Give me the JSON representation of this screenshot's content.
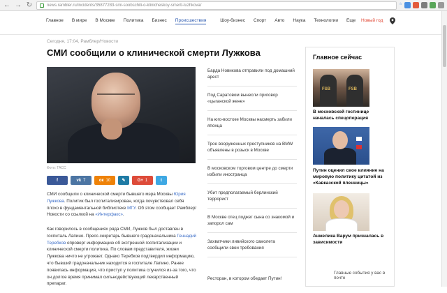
{
  "browser": {
    "url": "news.rambler.ru/incidents/35877283-smi-soobschili-o-klinicheskoy-smerti-luzhkova/"
  },
  "nav": {
    "items": [
      "Главное",
      "В мире",
      "В Москве",
      "Политика",
      "Бизнес",
      "Происшествия",
      "Шоу-бизнес",
      "Спорт",
      "Авто",
      "Наука",
      "Технологии",
      "Еще"
    ],
    "active": "Происшествия",
    "newyear": "Новый год"
  },
  "article": {
    "meta": "Сегодня, 17:04, Рамблер/Новости",
    "title": "СМИ сообщили о клинической смерти Лужкова",
    "photo_caption": "Фото: ТАСС",
    "share": {
      "vk": "7",
      "ok": "10",
      "gplus": "1"
    },
    "p1_a": "СМИ сообщили о клинической смерти бывшего мэра Москвы ",
    "p1_link1": "Юрия Лужкова",
    "p1_b": ". Политик был госпитализирован, когда почувствовал себя плохо в фундаментальной библиотеке ",
    "p1_link2": "МГУ",
    "p1_c": ". Об этом сообщает Рамблер/Новости со ссылкой на ",
    "p1_link3": "«Интерфакс»",
    "p1_d": ".",
    "p2_a": "Как говорилось в сообщениях ряда СМИ, Лужков был доставлен в госпиталь Лапино. Пресс-секретарь бывшего градоначальника ",
    "p2_link": "Геннадий Теребков",
    "p2_b": " опроверг информацию об экстренной госпитализации и клинической смерти политика. По словам представителя, жизни Лужкова ничто не угрожает. Однако Теребков подтвердил информацию, что бывший градоначальник находится в госпитале Лапино. Ранее появилась информация, что приступ у политика случился из-за того, что он долгое время принимал сильнодействующий лекарственный препарат."
  },
  "middle": {
    "items": [
      "Барда Новикова отправили под домашний арест",
      "Под Саратовом вынесли приговор «цыганской жене»",
      "На юго-востоке Москвы насмерть забили японца",
      "Трое вооруженных преступников на BMW объявлены в розыск в Москве",
      "В московском торговом центре до смерти избили иностранца",
      "Убит предполагаемый берлинский террорист",
      "В Москве отец поджег сына со знакомой и запорол сам",
      "Захватчики ливийского самолета сообщили свои требования",
      "Ресторан, в котором обедает Путин!"
    ]
  },
  "right": {
    "title": "Главное сейчас",
    "items": [
      "В московской гостинице началась спецоперация",
      "Путин оценил свое влияние на мировую политику цитатой из «Кавказской пленницы»",
      "Анжелика Варум призналась в зависимости"
    ],
    "fsb_label": "FSB",
    "footer": "Главные события у вас в почте"
  }
}
